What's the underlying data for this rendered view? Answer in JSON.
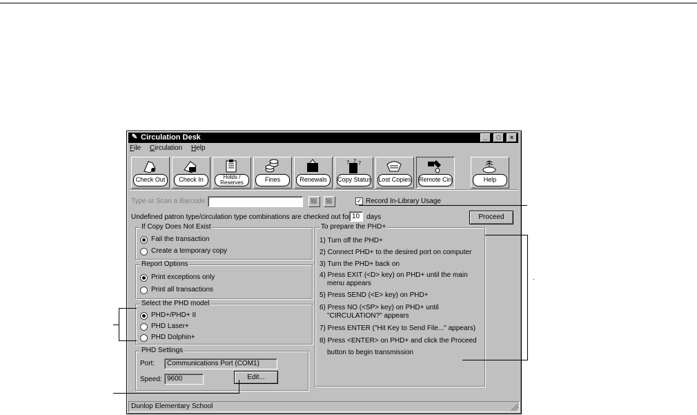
{
  "window": {
    "title": "Circulation Desk",
    "controls": [
      "_",
      "□",
      "×"
    ]
  },
  "menu": [
    {
      "label": "File",
      "key": "F",
      "rest": "ile"
    },
    {
      "label": "Circulation",
      "key": "C",
      "rest": "irculation"
    },
    {
      "label": "Help",
      "key": "H",
      "rest": "elp"
    }
  ],
  "toolbar": [
    {
      "label": "Check Out",
      "icon": "check-out-icon"
    },
    {
      "label": "Check In",
      "icon": "check-in-icon"
    },
    {
      "label": "Holds / Reserves",
      "line1": "Holds /",
      "line2": "Reserves",
      "icon": "holds-icon"
    },
    {
      "label": "Fines",
      "icon": "fines-icon"
    },
    {
      "label": "Renewals",
      "icon": "renewals-icon"
    },
    {
      "label": "Copy Status",
      "icon": "copy-status-icon"
    },
    {
      "label": "Lost Copies",
      "icon": "lost-copies-icon"
    },
    {
      "label": "Remote Circ",
      "icon": "remote-circ-icon"
    },
    {
      "label": "Help",
      "icon": "help-icon"
    }
  ],
  "barcode": {
    "label": "Type or Scan a Barcode:",
    "value": ""
  },
  "record_usage": {
    "label": "Record In-Library Usage",
    "checked": true
  },
  "checkout_note": {
    "before": "Undefined patron type/circulation type combinations are checked out for",
    "days": "10",
    "after": "days"
  },
  "proceed_label": "Proceed",
  "copy_not_exist": {
    "title": "If Copy Does Not Exist",
    "options": [
      {
        "label": "Fail the transaction",
        "selected": true
      },
      {
        "label": "Create a temporary copy",
        "selected": false
      }
    ]
  },
  "report_options": {
    "title": "Report Options",
    "options": [
      {
        "label": "Print exceptions only",
        "selected": true
      },
      {
        "label": "Print all transactions",
        "selected": false
      }
    ]
  },
  "phd_model": {
    "title": "Select the PHD model",
    "options": [
      {
        "label": "PHD+/PHD+ II",
        "selected": true
      },
      {
        "label": "PHD Laser+",
        "selected": false
      },
      {
        "label": "PHD Dolphin+",
        "selected": false
      }
    ]
  },
  "phd_settings": {
    "title": "PHD Settings",
    "port_label": "Port:",
    "port_value": "Communications Port (COM1)",
    "speed_label": "Speed:",
    "speed_value": "9600",
    "edit_label": "Edit..."
  },
  "prepare": {
    "title": "To prepare the PHD+",
    "steps": [
      [
        "1) Turn off the PHD+"
      ],
      [
        "2) Connect PHD+ to the desired port on computer"
      ],
      [
        "3) Turn the PHD+ back on"
      ],
      [
        "4) Press EXIT (<D> key) on PHD+ until the main",
        "menu appears"
      ],
      [
        "5) Press SEND (<E> key) on PHD+"
      ],
      [
        "6) Press NO (<SP> key) on PHD+ until",
        "\"CIRCULATION?\" appears"
      ],
      [
        "7) Press ENTER (\"Hit Key to Send File...\" appears)"
      ],
      [
        "8) Press <ENTER> on PHD+ and click the Proceed",
        "button to begin transmission"
      ]
    ]
  },
  "status": "Dunlop Elementary School"
}
